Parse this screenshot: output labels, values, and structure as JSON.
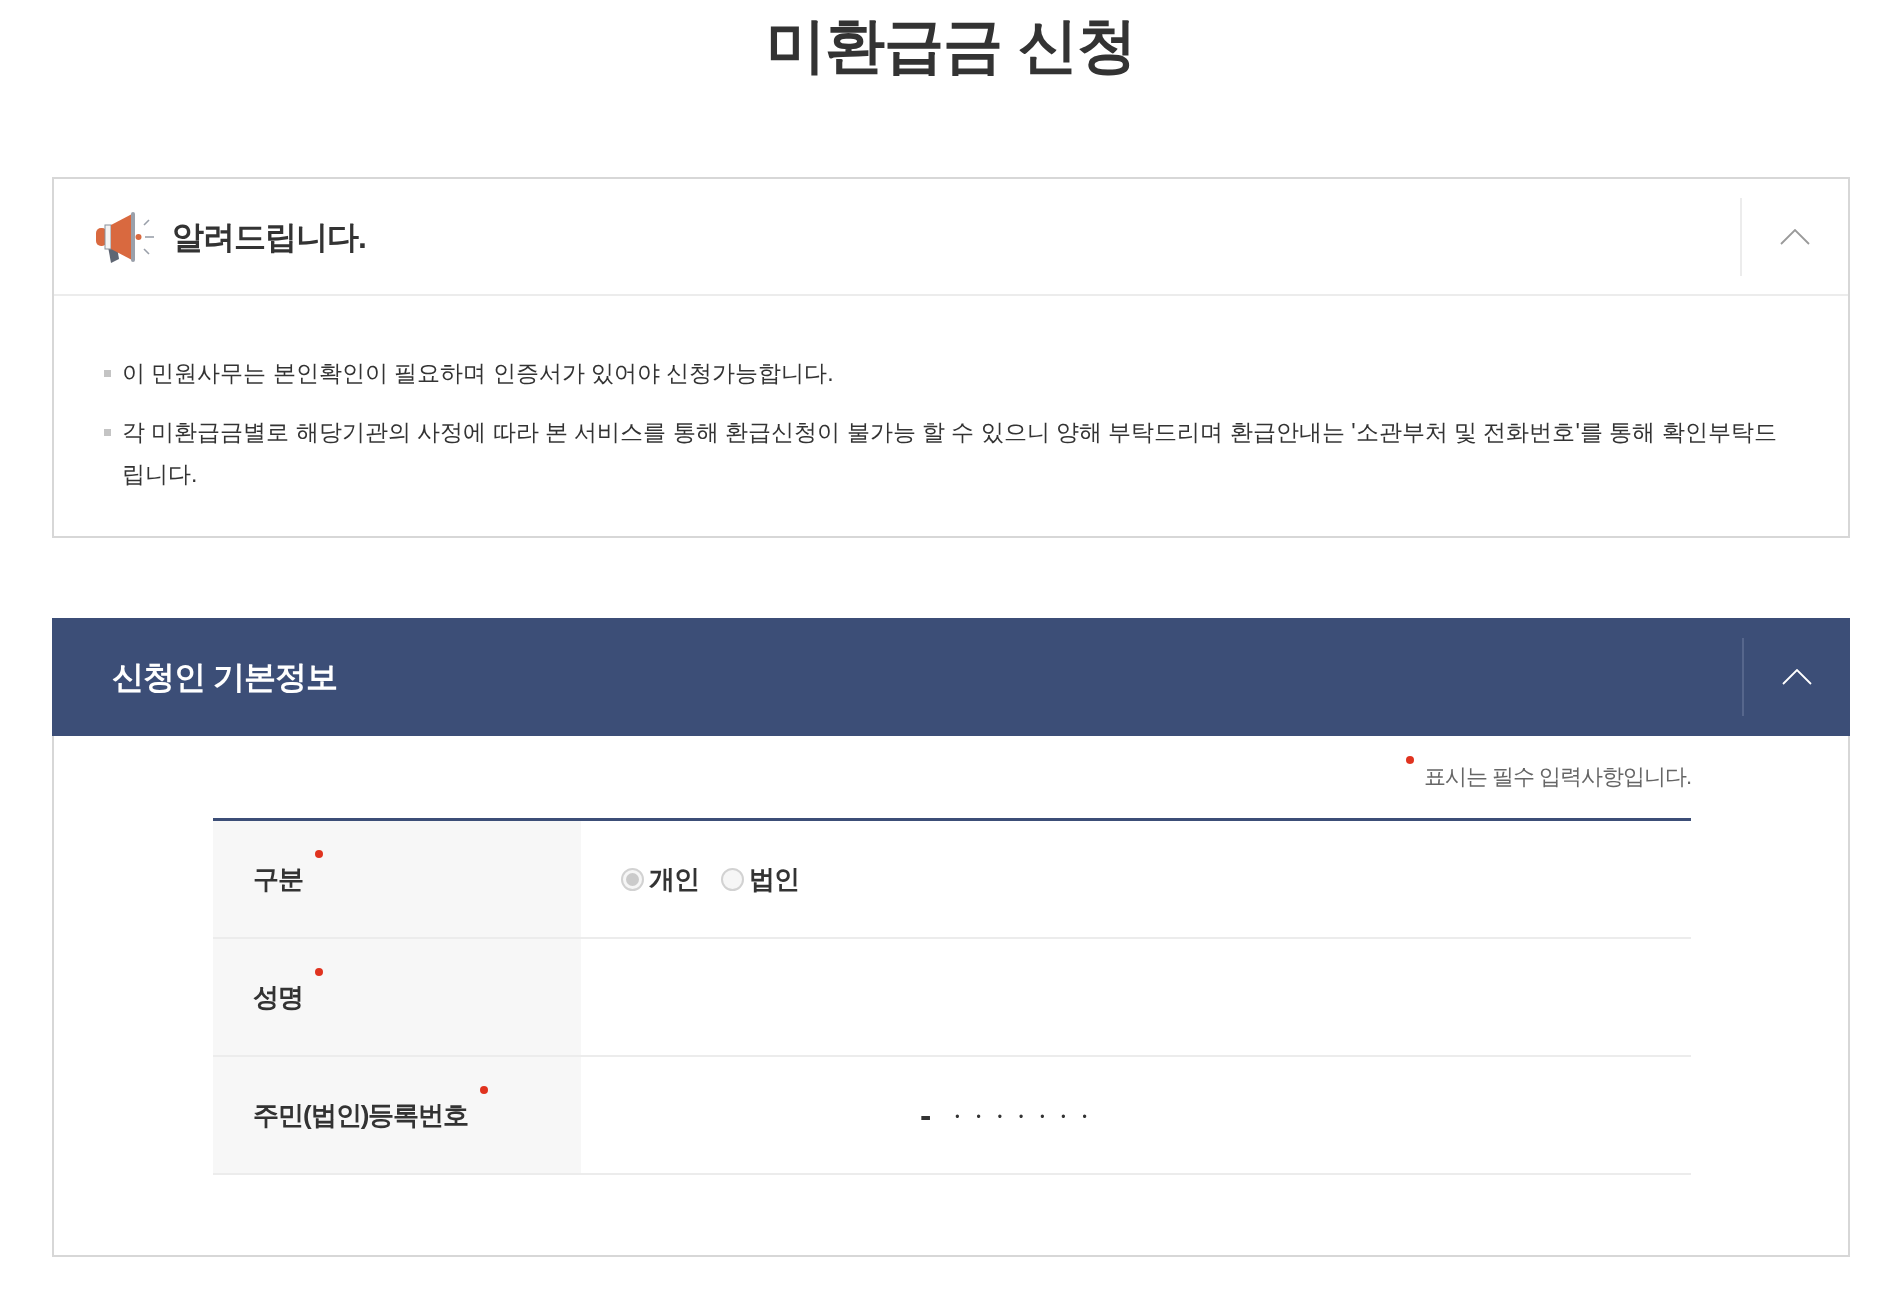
{
  "page": {
    "title": "미환급금 신청"
  },
  "notice": {
    "title": "알려드립니다.",
    "expanded": true,
    "items": [
      "이 민원사무는 본인확인이 필요하며 인증서가 있어야 신청가능합니다.",
      "각 미환급금별로 해당기관의 사정에 따라 본 서비스를 통해 환급신청이 불가능 할 수 있으니 양해 부탁드리며 환급안내는 '소관부처 및 전화번호'를 통해 확인부탁드립니다."
    ]
  },
  "applicant_section": {
    "title": "신청인 기본정보",
    "expanded": true,
    "required_note": "표시는 필수 입력사항입니다.",
    "rows": [
      {
        "kind": "radio",
        "label": "구분",
        "required": true,
        "options": [
          {
            "label": "개인",
            "selected": true
          },
          {
            "label": "법인",
            "selected": false
          }
        ]
      },
      {
        "kind": "text",
        "label": "성명",
        "required": true
      },
      {
        "kind": "id_number",
        "label": "주민(법인)등록번호",
        "required": true,
        "separator": "-",
        "masked_value": "•••••••"
      }
    ]
  }
}
